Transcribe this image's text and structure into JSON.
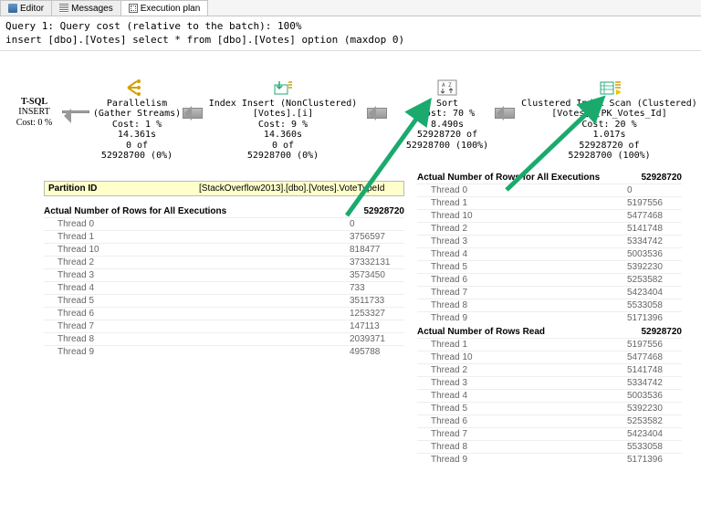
{
  "tabs": [
    {
      "label": "Editor"
    },
    {
      "label": "Messages"
    },
    {
      "label": "Execution plan"
    }
  ],
  "query": {
    "line1": "Query 1: Query cost (relative to the batch): 100%",
    "line2": "insert [dbo].[Votes] select * from [dbo].[Votes] option (maxdop 0)"
  },
  "nodes": {
    "tsql": {
      "name": "T-SQL",
      "l1": "INSERT",
      "l2": "Cost: 0 %"
    },
    "parallelism": {
      "title": "Parallelism",
      "sub": "(Gather Streams)",
      "cost": "Cost: 1 %",
      "time": "14.361s",
      "of": "0 of",
      "rows": "52928700 (0%)"
    },
    "indexinsert": {
      "title": "Index Insert (NonClustered)",
      "sub": "[Votes].[i]",
      "cost": "Cost: 9 %",
      "time": "14.360s",
      "of": "0 of",
      "rows": "52928700 (0%)"
    },
    "sort": {
      "title": "Sort",
      "cost": "Cost: 70 %",
      "time": "8.490s",
      "of": "52928720 of",
      "rows": "52928700 (100%)"
    },
    "scan": {
      "title": "Clustered Index Scan (Clustered)",
      "sub": "[Votes].[PK_Votes_Id]",
      "cost": "Cost: 20 %",
      "time": "1.017s",
      "of": "52928720 of",
      "rows": "52928700 (100%)"
    }
  },
  "leftPanel": {
    "partition": {
      "label": "Partition ID",
      "value": "[StackOverflow2013].[dbo].[Votes].VoteTypeId"
    },
    "hdr": {
      "label": "Actual Number of Rows for All Executions",
      "value": "52928720"
    },
    "threads": [
      {
        "label": "Thread 0",
        "value": "0"
      },
      {
        "label": "Thread 1",
        "value": "3756597"
      },
      {
        "label": "Thread 10",
        "value": "818477"
      },
      {
        "label": "Thread 2",
        "value": "37332131"
      },
      {
        "label": "Thread 3",
        "value": "3573450"
      },
      {
        "label": "Thread 4",
        "value": "733"
      },
      {
        "label": "Thread 5",
        "value": "3511733"
      },
      {
        "label": "Thread 6",
        "value": "1253327"
      },
      {
        "label": "Thread 7",
        "value": "147113"
      },
      {
        "label": "Thread 8",
        "value": "2039371"
      },
      {
        "label": "Thread 9",
        "value": "495788"
      }
    ]
  },
  "rightPanel": {
    "hdr1": {
      "label": "Actual Number of Rows for All Executions",
      "value": "52928720"
    },
    "threads1": [
      {
        "label": "Thread 0",
        "value": "0"
      },
      {
        "label": "Thread 1",
        "value": "5197556"
      },
      {
        "label": "Thread 10",
        "value": "5477468"
      },
      {
        "label": "Thread 2",
        "value": "5141748"
      },
      {
        "label": "Thread 3",
        "value": "5334742"
      },
      {
        "label": "Thread 4",
        "value": "5003536"
      },
      {
        "label": "Thread 5",
        "value": "5392230"
      },
      {
        "label": "Thread 6",
        "value": "5253582"
      },
      {
        "label": "Thread 7",
        "value": "5423404"
      },
      {
        "label": "Thread 8",
        "value": "5533058"
      },
      {
        "label": "Thread 9",
        "value": "5171396"
      }
    ],
    "hdr2": {
      "label": "Actual Number of Rows Read",
      "value": "52928720"
    },
    "threads2": [
      {
        "label": "Thread 1",
        "value": "5197556"
      },
      {
        "label": "Thread 10",
        "value": "5477468"
      },
      {
        "label": "Thread 2",
        "value": "5141748"
      },
      {
        "label": "Thread 3",
        "value": "5334742"
      },
      {
        "label": "Thread 4",
        "value": "5003536"
      },
      {
        "label": "Thread 5",
        "value": "5392230"
      },
      {
        "label": "Thread 6",
        "value": "5253582"
      },
      {
        "label": "Thread 7",
        "value": "5423404"
      },
      {
        "label": "Thread 8",
        "value": "5533058"
      },
      {
        "label": "Thread 9",
        "value": "5171396"
      }
    ]
  }
}
